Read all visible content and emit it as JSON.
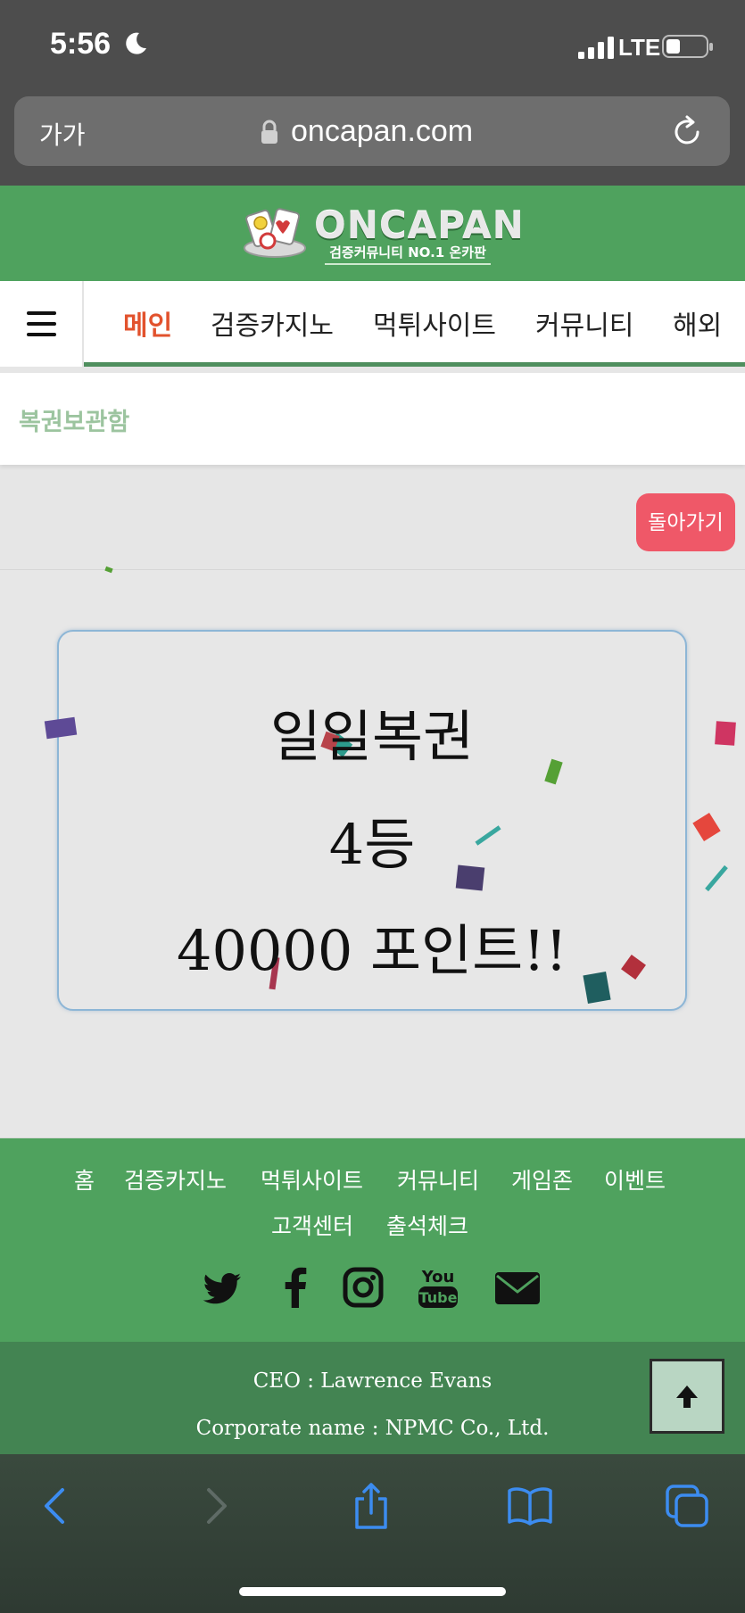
{
  "status_bar": {
    "time": "5:56",
    "network": "LTE"
  },
  "browser": {
    "text_size_label": "가가",
    "url": "oncapan.com"
  },
  "site": {
    "logo_text": "ONCAPAN",
    "logo_tagline": "검증커뮤니티 NO.1 온카판",
    "nav": [
      "메인",
      "검증카지노",
      "먹튀사이트",
      "커뮤니티",
      "해외"
    ],
    "active_nav": "메인",
    "page_title": "복권보관함",
    "back_button": "돌아가기"
  },
  "result_card": {
    "line1": "일일복권",
    "line2": "4등",
    "line3": "40000 포인트!!"
  },
  "footer": {
    "links_row1": [
      "홈",
      "검증카지노",
      "먹튀사이트",
      "커뮤니티",
      "게임존",
      "이벤트"
    ],
    "links_row2": [
      "고객센터",
      "출석체크"
    ],
    "social_icons": [
      "twitter-icon",
      "facebook-icon",
      "instagram-icon",
      "youtube-icon",
      "email-icon"
    ],
    "ceo": "CEO : Lawrence Evans",
    "corporate_name": "Corporate name : NPMC Co., Ltd."
  },
  "colors": {
    "brand_green": "#4fa25e",
    "active_nav": "#e2522d",
    "back_button": "#ef5868",
    "subtitle": "#9cc49f"
  }
}
